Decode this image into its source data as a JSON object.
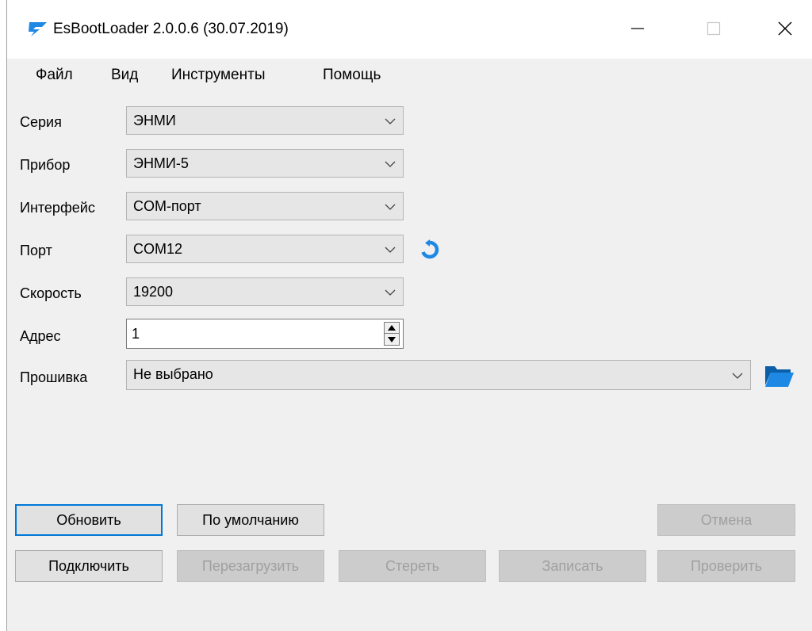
{
  "window": {
    "title": "EsBootLoader 2.0.0.6 (30.07.2019)"
  },
  "menu": {
    "items": [
      "Файл",
      "Вид",
      "Инструменты",
      "Помощь"
    ]
  },
  "form": {
    "series": {
      "label": "Серия",
      "value": "ЭНМИ"
    },
    "device": {
      "label": "Прибор",
      "value": "ЭНМИ-5"
    },
    "interface": {
      "label": "Интерфейс",
      "value": "COM-порт"
    },
    "port": {
      "label": "Порт",
      "value": "COM12"
    },
    "speed": {
      "label": "Скорость",
      "value": "19200"
    },
    "address": {
      "label": "Адрес",
      "value": "1"
    },
    "firmware": {
      "label": "Прошивка",
      "value": "Не выбрано"
    }
  },
  "buttons": {
    "refresh": "Обновить",
    "defaults": "По умолчанию",
    "cancel": "Отмена",
    "connect": "Подключить",
    "reboot": "Перезагрузить",
    "erase": "Стереть",
    "write": "Записать",
    "verify": "Проверить"
  },
  "icons": {
    "app": "bolt-logo-icon",
    "refresh_port": "refresh-icon",
    "open_firmware": "folder-icon"
  },
  "colors": {
    "accent": "#0078d7",
    "icon_blue": "#1e88e5"
  }
}
